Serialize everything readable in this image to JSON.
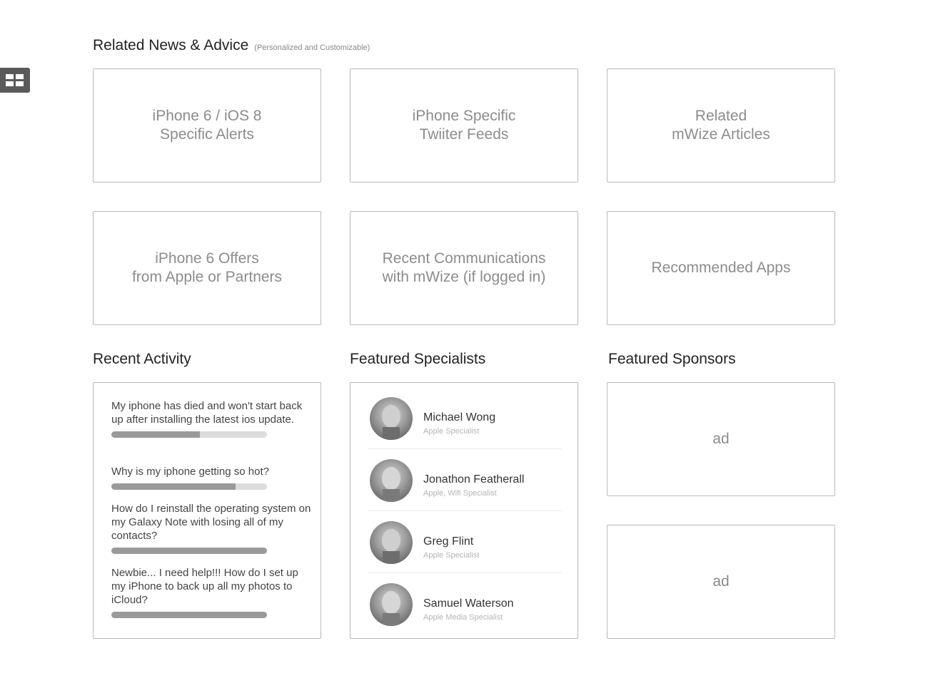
{
  "sidebar_toggle": {
    "icon": "grid-icon"
  },
  "news": {
    "title": "Related News & Advice",
    "subtitle": "(Personalized and Customizable)",
    "tiles": [
      {
        "label": "iPhone 6 / iOS 8\nSpecific Alerts"
      },
      {
        "label": "iPhone Specific\nTwiiter Feeds"
      },
      {
        "label": "Related\nmWize Articles"
      },
      {
        "label": "iPhone 6 Offers\nfrom Apple or Partners"
      },
      {
        "label": "Recent Communications\nwith mWize (if logged in)"
      },
      {
        "label": "Recommended Apps"
      }
    ]
  },
  "recent_activity": {
    "title": "Recent Activity",
    "items": [
      {
        "text": "My iphone has died and won't start back up after installing the latest ios update.",
        "progress": 0.57
      },
      {
        "text": "Why is my iphone getting so hot?",
        "progress": 0.8
      },
      {
        "text": "How do I reinstall the operating system on my Galaxy Note with losing all of my contacts?",
        "progress": 1.0
      },
      {
        "text": "Newbie... I need help!!! How do I set up my iPhone to back up all my photos to iCloud?",
        "progress": 1.0
      }
    ]
  },
  "featured_specialists": {
    "title": "Featured Specialists",
    "items": [
      {
        "name": "Michael Wong",
        "role": "Apple Specialist"
      },
      {
        "name": "Jonathon Featherall",
        "role": "Apple, Wifi Specialist"
      },
      {
        "name": "Greg Flint",
        "role": "Apple Specialist"
      },
      {
        "name": "Samuel Waterson",
        "role": "Apple Media Specialist"
      }
    ]
  },
  "featured_sponsors": {
    "title": "Featured Sponsors",
    "ads": [
      {
        "label": "ad"
      },
      {
        "label": "ad"
      }
    ]
  }
}
